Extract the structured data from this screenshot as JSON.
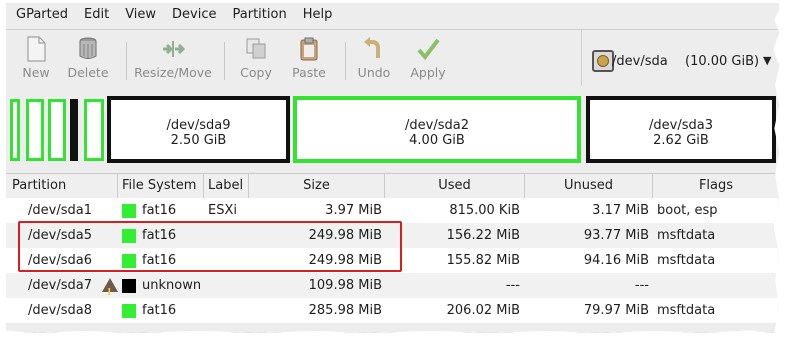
{
  "menubar": [
    {
      "label": "GParted"
    },
    {
      "label": "Edit"
    },
    {
      "label": "View"
    },
    {
      "label": "Device"
    },
    {
      "label": "Partition"
    },
    {
      "label": "Help"
    }
  ],
  "toolbar": {
    "new": "New",
    "delete": "Delete",
    "resize_move": "Resize/Move",
    "copy": "Copy",
    "paste": "Paste",
    "undo": "Undo",
    "apply": "Apply"
  },
  "device": {
    "name": "/dev/sda",
    "size": "(10.00 GiB)"
  },
  "partition_map": [
    {
      "name": "/dev/sda9",
      "size": "2.50 GiB",
      "style": "black"
    },
    {
      "name": "/dev/sda2",
      "size": "4.00 GiB",
      "style": "green"
    },
    {
      "name": "/dev/sda3",
      "size": "2.62 GiB",
      "style": "black"
    }
  ],
  "table": {
    "headers": {
      "partition": "Partition",
      "filesystem": "File System",
      "label": "Label",
      "size": "Size",
      "used": "Used",
      "unused": "Unused",
      "flags": "Flags"
    },
    "rows": [
      {
        "partition": "/dev/sda1",
        "fs": "fat16",
        "fs_color": "#33ee33",
        "label": "ESXi",
        "size": "3.97 MiB",
        "used": "815.00 KiB",
        "unused": "3.17 MiB",
        "flags": "boot, esp",
        "warning": false
      },
      {
        "partition": "/dev/sda5",
        "fs": "fat16",
        "fs_color": "#33ee33",
        "label": "",
        "size": "249.98 MiB",
        "used": "156.22 MiB",
        "unused": "93.77 MiB",
        "flags": "msftdata",
        "warning": false
      },
      {
        "partition": "/dev/sda6",
        "fs": "fat16",
        "fs_color": "#33ee33",
        "label": "",
        "size": "249.98 MiB",
        "used": "155.82 MiB",
        "unused": "94.16 MiB",
        "flags": "msftdata",
        "warning": false
      },
      {
        "partition": "/dev/sda7",
        "fs": "unknown",
        "fs_color": "#000000",
        "label": "",
        "size": "109.98 MiB",
        "used": "---",
        "unused": "---",
        "flags": "",
        "warning": true
      },
      {
        "partition": "/dev/sda8",
        "fs": "fat16",
        "fs_color": "#33ee33",
        "label": "",
        "size": "285.98 MiB",
        "used": "206.02 MiB",
        "unused": "79.97 MiB",
        "flags": "msftdata",
        "warning": false
      }
    ]
  }
}
